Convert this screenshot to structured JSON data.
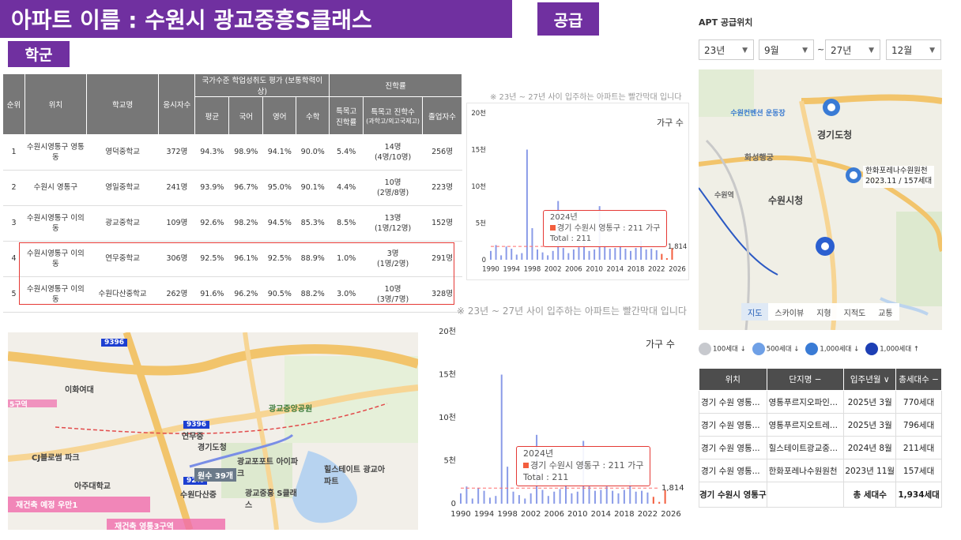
{
  "header": {
    "title": "아파트 이름 : 수원시 광교중흥S클래스",
    "supply_badge": "공급",
    "school_badge": "학군"
  },
  "school_table": {
    "headers": {
      "rank": "순위",
      "location": "위치",
      "school": "학교명",
      "examinees": "응시자수",
      "national_group": "국가수준 학업성취도 평가 (보통학력이상)",
      "avg": "평균",
      "korean": "국어",
      "english": "영어",
      "math": "수학",
      "advancement_group": "진학률",
      "special_rate": "특목고 진학률",
      "special_count": "특목고 진학수",
      "special_count_sub": "(과학고/외고국제고)",
      "graduates": "졸업자수"
    },
    "rows": [
      {
        "rank": "1",
        "location": "수원시영통구 영통동",
        "school": "영덕중학교",
        "examinees": "372명",
        "avg": "94.3%",
        "korean": "98.9%",
        "english": "94.1%",
        "math": "90.0%",
        "special_rate": "5.4%",
        "special_count": "14명",
        "special_detail": "(4명/10명)",
        "graduates": "256명"
      },
      {
        "rank": "2",
        "location": "수원시 영통구",
        "school": "영일중학교",
        "examinees": "241명",
        "avg": "93.9%",
        "korean": "96.7%",
        "english": "95.0%",
        "math": "90.1%",
        "special_rate": "4.4%",
        "special_count": "10명",
        "special_detail": "(2명/8명)",
        "graduates": "223명"
      },
      {
        "rank": "3",
        "location": "수원시영통구 이의동",
        "school": "광교중학교",
        "examinees": "109명",
        "avg": "92.6%",
        "korean": "98.2%",
        "english": "94.5%",
        "math": "85.3%",
        "special_rate": "8.5%",
        "special_count": "13명",
        "special_detail": "(1명/12명)",
        "graduates": "152명"
      },
      {
        "rank": "4",
        "location": "수원시영통구 이의동",
        "school": "연무중학교",
        "examinees": "306명",
        "avg": "92.5%",
        "korean": "96.1%",
        "english": "92.5%",
        "math": "88.9%",
        "special_rate": "1.0%",
        "special_count": "3명",
        "special_detail": "(1명/2명)",
        "graduates": "291명"
      },
      {
        "rank": "5",
        "location": "수원시영통구 이의동",
        "school": "수원다산중학교",
        "examinees": "262명",
        "avg": "91.6%",
        "korean": "96.2%",
        "english": "90.5%",
        "math": "88.2%",
        "special_rate": "3.0%",
        "special_count": "10명",
        "special_detail": "(3명/7명)",
        "graduates": "328명"
      }
    ]
  },
  "chart_note": "※ 23년 ~ 27년 사이 입주하는 아파트는 빨간막대 입니다",
  "chart_legend": "가구 수",
  "tooltip": {
    "year": "2024년",
    "line": "경기 수원시 영통구 : 211 가구",
    "total": "Total : 211"
  },
  "chart_data": [
    {
      "type": "bar",
      "ylabel": "가구 수",
      "yticks": [
        "0",
        "5천",
        "10천",
        "15천",
        "20천"
      ],
      "ylim": [
        0,
        20000
      ],
      "xticks": [
        "1990",
        "1994",
        "1998",
        "2002",
        "2006",
        "2010",
        "2014",
        "2018",
        "2022",
        "2026"
      ],
      "avg_line": 1814,
      "avg_label": "1,814",
      "series": [
        {
          "values": [
            [
              1990,
              1200
            ],
            [
              1991,
              2000
            ],
            [
              1992,
              600
            ],
            [
              1993,
              1800
            ],
            [
              1994,
              1500
            ],
            [
              1995,
              700
            ],
            [
              1996,
              900
            ],
            [
              1997,
              15000
            ],
            [
              1998,
              4300
            ],
            [
              1999,
              1400
            ],
            [
              2000,
              1000
            ],
            [
              2001,
              600
            ],
            [
              2002,
              1200
            ],
            [
              2003,
              8000
            ],
            [
              2004,
              1600
            ],
            [
              2005,
              900
            ],
            [
              2006,
              1400
            ],
            [
              2007,
              1700
            ],
            [
              2008,
              2300
            ],
            [
              2009,
              1200
            ],
            [
              2010,
              1400
            ],
            [
              2011,
              7300
            ],
            [
              2012,
              2000
            ],
            [
              2013,
              1500
            ],
            [
              2014,
              1600
            ],
            [
              2015,
              2000
            ],
            [
              2016,
              1500
            ],
            [
              2017,
              1200
            ],
            [
              2018,
              1600
            ],
            [
              2019,
              2600
            ],
            [
              2020,
              1400
            ],
            [
              2021,
              1500
            ],
            [
              2022,
              1300
            ],
            [
              2023,
              796
            ],
            [
              2024,
              211
            ],
            [
              2025,
              1566
            ]
          ]
        }
      ],
      "highlight_years": [
        2023,
        2024,
        2025
      ]
    }
  ],
  "apt_panel": {
    "heading": "APT 공급위치",
    "selects": {
      "start_year": "23년",
      "start_month": "9월",
      "end_year": "27년",
      "end_month": "12월"
    },
    "range_sep": "~",
    "map_tabs": [
      "지도",
      "스카이뷰",
      "지형",
      "지적도",
      "교통"
    ],
    "legend": [
      "100세대 ↓",
      "500세대 ↓",
      "1,000세대 ↓",
      "1,000세대 ↑"
    ],
    "map_labels": {
      "park": "수원컨벤션 운동장",
      "dohall": "경기도청",
      "cityhall": "수원시청",
      "apt_name": "한화포레나수원원천",
      "apt_info": "2023.11 / 157세대",
      "hwaseong": "화성행궁",
      "station": "수원역"
    },
    "table": {
      "headers": [
        "위치",
        "단지명 −",
        "입주년월 ∨",
        "총세대수 −"
      ],
      "rows": [
        [
          "경기 수원 영통...",
          "영통푸르지오파인...",
          "2025년 3월",
          "770세대"
        ],
        [
          "경기 수원 영통...",
          "영통푸르지오트레...",
          "2025년 3월",
          "796세대"
        ],
        [
          "경기 수원 영통...",
          "힐스테이트광교중...",
          "2024년 8월",
          "211세대"
        ],
        [
          "경기 수원 영통...",
          "한화포레나수원원천",
          "2023년 11월",
          "157세대"
        ]
      ],
      "total_row": {
        "location": "경기 수원시 영통구",
        "label": "총 세대수",
        "value": "1,934세대"
      }
    }
  },
  "school_map": {
    "labels": {
      "loc1": "9396",
      "loc2": "9396",
      "loc3": "92%",
      "ewha": "이화여대",
      "yeonmu": "연무중",
      "gyeonggi": "경기도청",
      "gwangyo_park": "광교중앙공원",
      "gwangyo_plaza": "광교포포트 아이파크",
      "cj": "CJ블로썸 파크",
      "ajou": "아주대학교",
      "suwon_dasan": "수원다산중",
      "sclass": "광교중흥 S클래스",
      "hills": "힐스테이트 광교아파트",
      "redev1": "재건축 예정 우만1",
      "redev2": "재건축 영통3구역",
      "red_left": "5구역",
      "school_count": "원수 39개"
    }
  },
  "colors": {
    "purple": "#7030a0",
    "bar": "#8a9be8",
    "bar_red": "#f35e3e",
    "avg_line": "#ff6e6e"
  }
}
